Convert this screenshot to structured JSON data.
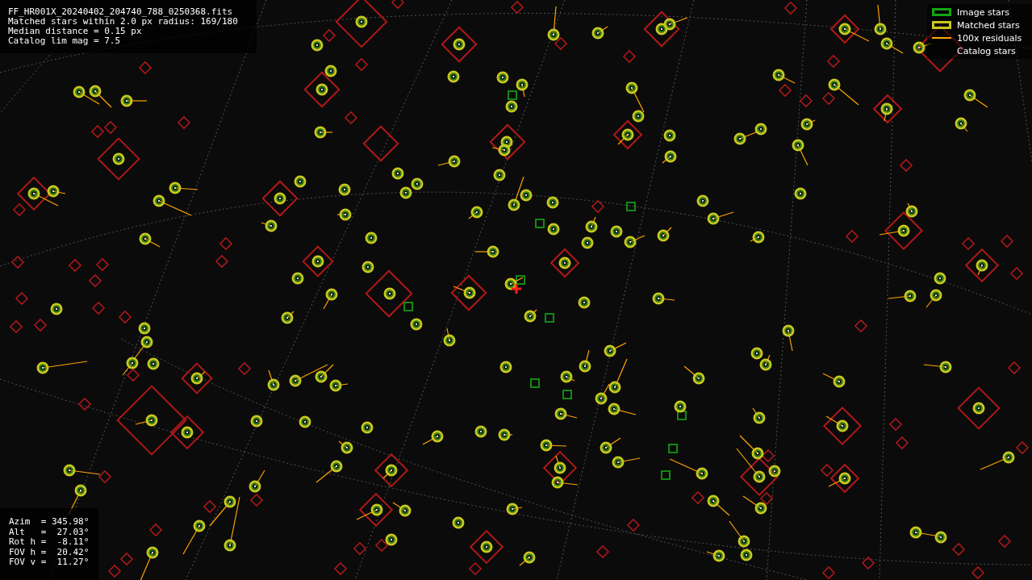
{
  "file_info": {
    "lines": [
      "FF_HR001X_20240402_204740_788_0250368.fits",
      "Matched stars within 2.0 px radius: 169/180",
      "Median distance = 0.15 px",
      "Catalog lim mag = 7.5"
    ]
  },
  "legend": [
    {
      "kind": "box",
      "color": "#11a611",
      "label": "Image stars"
    },
    {
      "kind": "box",
      "color": "#c8c81e",
      "label": "Matched stars"
    },
    {
      "kind": "line",
      "color": "#ffa500",
      "label": "100x residuals"
    },
    {
      "kind": "none",
      "label": "Catalog stars"
    }
  ],
  "pointing": {
    "lines": [
      "Azim  = 345.98°",
      "Alt   =  27.03°",
      "Rot h =  -8.11°",
      "FOV h =  20.42°",
      "FOV v =  11.27°"
    ]
  }
}
